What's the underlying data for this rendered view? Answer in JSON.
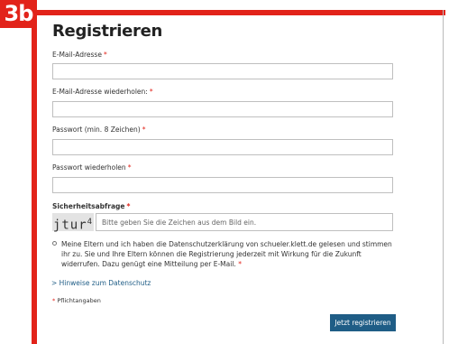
{
  "step_badge": "3b",
  "form": {
    "title": "Registrieren",
    "required_marker": "*",
    "fields": {
      "email": {
        "label": "E-Mail-Adresse",
        "value": ""
      },
      "email_repeat": {
        "label": "E-Mail-Adresse wiederholen:",
        "value": ""
      },
      "password": {
        "label": "Passwort (min. 8 Zeichen)",
        "value": ""
      },
      "password_repeat": {
        "label": "Passwort wiederholen",
        "value": ""
      }
    },
    "captcha": {
      "label": "Sicherheitsabfrage",
      "image_text": "jtur",
      "image_text_sup": "4",
      "placeholder": "Bitte geben Sie die Zeichen aus dem Bild ein."
    },
    "consent": {
      "checked": false,
      "text": "Meine Eltern und ich haben die Datenschutzerklärung von schueler.klett.de gelesen und stimmen ihr zu. Sie und Ihre Eltern können die Registrierung jederzeit mit Wirkung für die Zukunft widerrufen. Dazu genügt eine Mitteilung per E-Mail."
    },
    "privacy_link": "> Hinweise zum Datenschutz",
    "required_note": "Pflichtangaben",
    "submit_label": "Jetzt registrieren"
  },
  "colors": {
    "accent_red": "#e2231a",
    "button_blue": "#1f5d86",
    "link_blue": "#1f5d86"
  }
}
